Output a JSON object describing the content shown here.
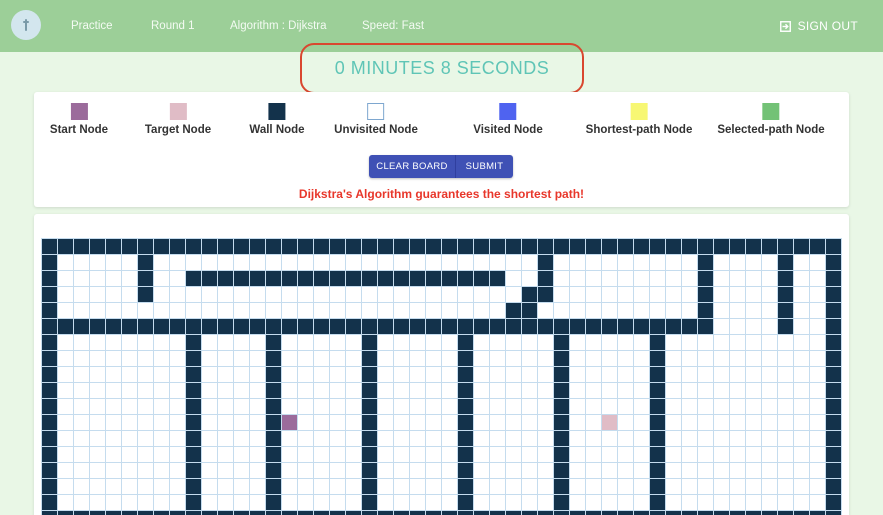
{
  "nav": {
    "items": [
      "Practice",
      "Round 1",
      "Algorithm : Dijkstra",
      "Speed: Fast"
    ],
    "signout": "SIGN OUT"
  },
  "timer": "0 MINUTES 8 SECONDS",
  "legend": [
    {
      "label": "Start Node",
      "color": "#9b6b9b"
    },
    {
      "label": "Target Node",
      "color": "#e0bcc6"
    },
    {
      "label": "Wall Node",
      "color": "#13324b"
    },
    {
      "label": "Unvisited Node",
      "color": "#ffffff"
    },
    {
      "label": "Visited Node",
      "color": "#4f63f0"
    },
    {
      "label": "Shortest-path Node",
      "color": "#f7f773"
    },
    {
      "label": "Selected-path Node",
      "color": "#73c276"
    }
  ],
  "buttons": {
    "clear": "CLEAR BOARD",
    "submit": "SUBMIT"
  },
  "message": "Dijkstra's Algorithm guarantees the shortest path!",
  "colors": {
    "wall": "#13324b",
    "unvisited": "#ffffff",
    "gridline": "#c5dcee",
    "start": "#9b6b9b",
    "target": "#e0bcc6"
  },
  "grid": {
    "rows": 18,
    "cols": 50,
    "start": [
      11,
      15
    ],
    "target": [
      11,
      35
    ],
    "map": [
      "##################################################",
      "#.....#........................#.........#....#..#",
      "#.....#..####################..#.........#....#..#",
      "#.....#.......................##.........#....#..#",
      "#............................##..........#....#..#",
      "##########################################....#..#",
      "#........#....#.....#.....#.....#.....#..........#",
      "#........#....#.....#.....#.....#.....#..........#",
      "#........#....#.....#.....#.....#.....#..........#",
      "#........#....#.....#.....#.....#.....#..........#",
      "#........#....#.....#.....#.....#.....#..........#",
      "#........#....#.....#.....#.....#.....#..........#",
      "#........#....#.....#.....#.....#.....#..........#",
      "#........#....#.....#.....#.....#.....#..........#",
      "#........#....#.....#.....#.....#.....#..........#",
      "#........#....#.....#.....#.....#.....#..........#",
      "#........#....#.....#.....#.....#.....#..........#",
      "##################################################"
    ]
  }
}
